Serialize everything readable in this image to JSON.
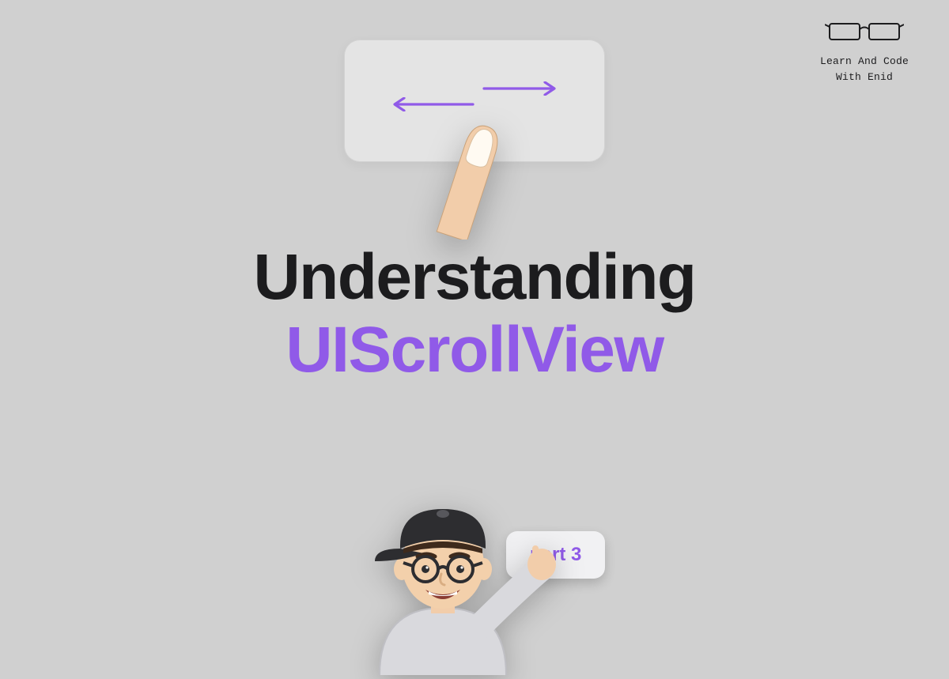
{
  "brand": {
    "line1": "Learn And Code",
    "line2": "With Enid"
  },
  "headline": {
    "line1": "Understanding",
    "line2": "UIScrollView"
  },
  "badge": {
    "label": "part 3"
  },
  "colors": {
    "accent": "#905ae8",
    "text": "#1c1c1e",
    "bg": "#d0d0d0"
  }
}
